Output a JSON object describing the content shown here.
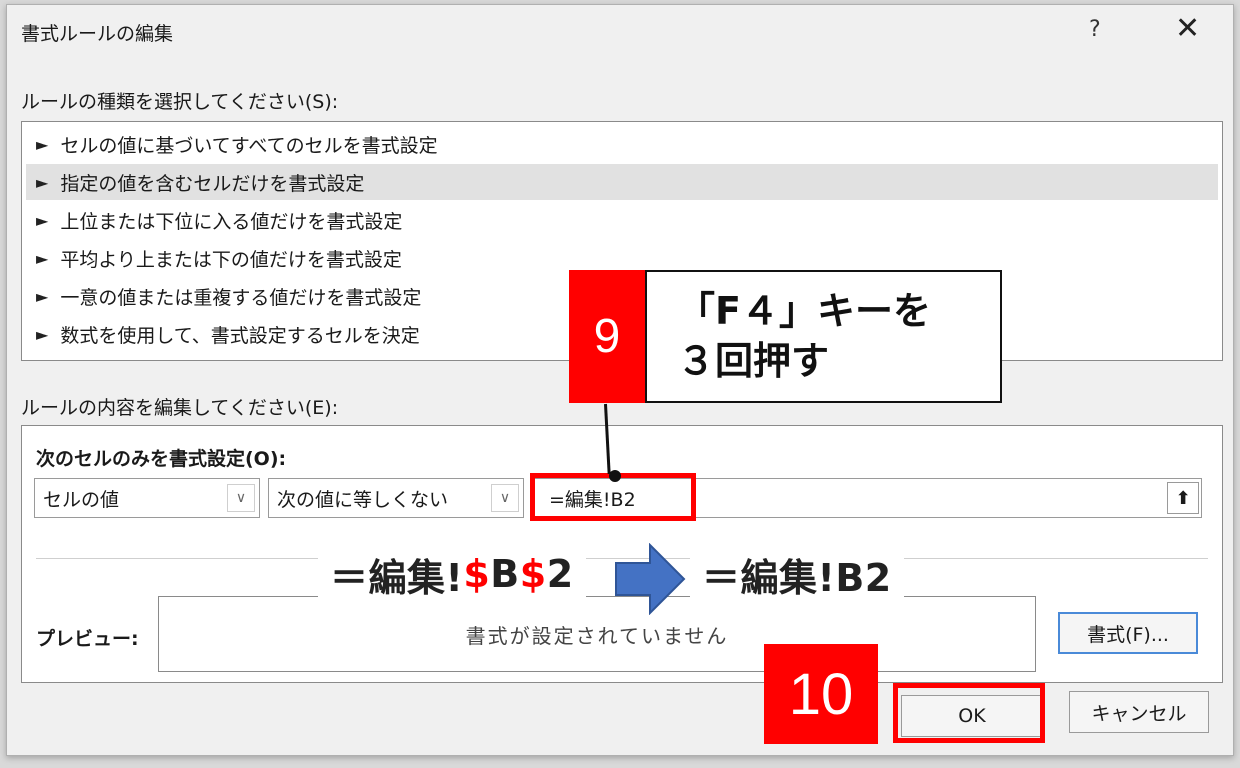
{
  "dialog": {
    "title": "書式ルールの編集",
    "help_label": "?",
    "close_label": "✕"
  },
  "rule_type": {
    "label": "ルールの種類を選択してください(S):",
    "items": [
      "セルの値に基づいてすべてのセルを書式設定",
      "指定の値を含むセルだけを書式設定",
      "上位または下位に入る値だけを書式設定",
      "平均より上または下の値だけを書式設定",
      "一意の値または重複する値だけを書式設定",
      "数式を使用して、書式設定するセルを決定"
    ],
    "selected_index": 1
  },
  "rule_edit": {
    "label": "ルールの内容を編集してください(E):",
    "sub_label": "次のセルのみを書式設定(O):",
    "combo1": "セルの値",
    "combo2": "次の値に等しくない",
    "formula": "=編集!B2",
    "preview_label": "プレビュー:",
    "preview_text": "書式が設定されていません",
    "format_button": "書式(F)..."
  },
  "buttons": {
    "ok": "OK",
    "cancel": "キャンセル"
  },
  "annotations": {
    "badge9": "9",
    "badge10": "10",
    "callout_line1": "「F４」キーを",
    "callout_line2": "３回押す",
    "before_prefix": "＝編集!",
    "before_dollar1": "$",
    "before_col": "B",
    "before_dollar2": "$",
    "before_row": "2",
    "after": "＝編集!B2"
  },
  "colors": {
    "highlight_red": "#ff0000",
    "arrow_blue": "#4472c4",
    "selected_row": "#e1e1e1"
  }
}
